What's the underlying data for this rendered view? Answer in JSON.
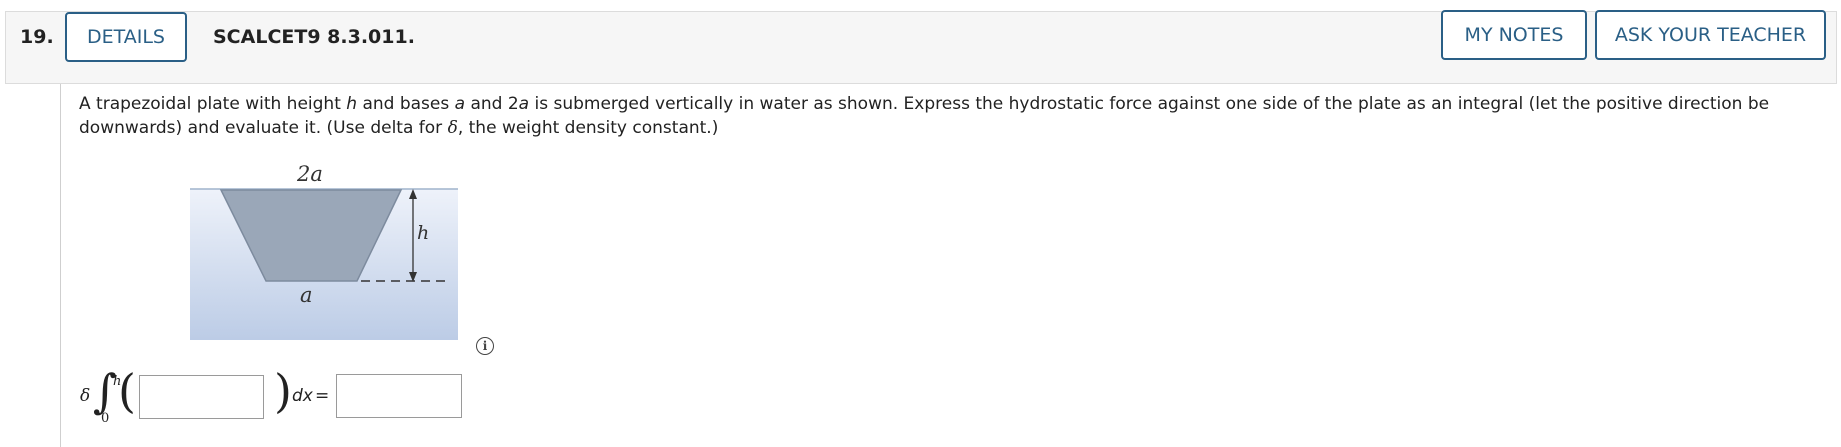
{
  "header": {
    "question_number": "19.",
    "details_label": "DETAILS",
    "problem_code": "SCALCET9 8.3.011.",
    "my_notes_label": "MY NOTES",
    "ask_teacher_label": "ASK YOUR TEACHER",
    "accent_color": "#2a5f86"
  },
  "prompt": {
    "part1": "A trapezoidal plate with height ",
    "h": "h",
    "part2": " and bases ",
    "a": "a",
    "part3": " and 2",
    "a2": "a",
    "part4": " is submerged vertically in water as shown. Express the hydrostatic force against one side of the plate as an integral (let the positive direction be downwards) and evaluate it. (Use delta for ",
    "delta": "δ",
    "part5": ", the weight density constant.)"
  },
  "figure": {
    "top_base_label": "2a",
    "bottom_base_label": "a",
    "height_label": "h",
    "water_color": "#c9d6ec",
    "plate_color": "#9aa7b8"
  },
  "info_icon": {
    "glyph": "i",
    "icon": "info-icon"
  },
  "answer": {
    "coefficient": "δ",
    "integral_sign": "∫",
    "upper_limit": "h",
    "lower_limit": "0",
    "open_paren": "(",
    "close_paren": ")",
    "differential": "dx",
    "equals": "=",
    "integrand_value": "",
    "result_value": ""
  }
}
